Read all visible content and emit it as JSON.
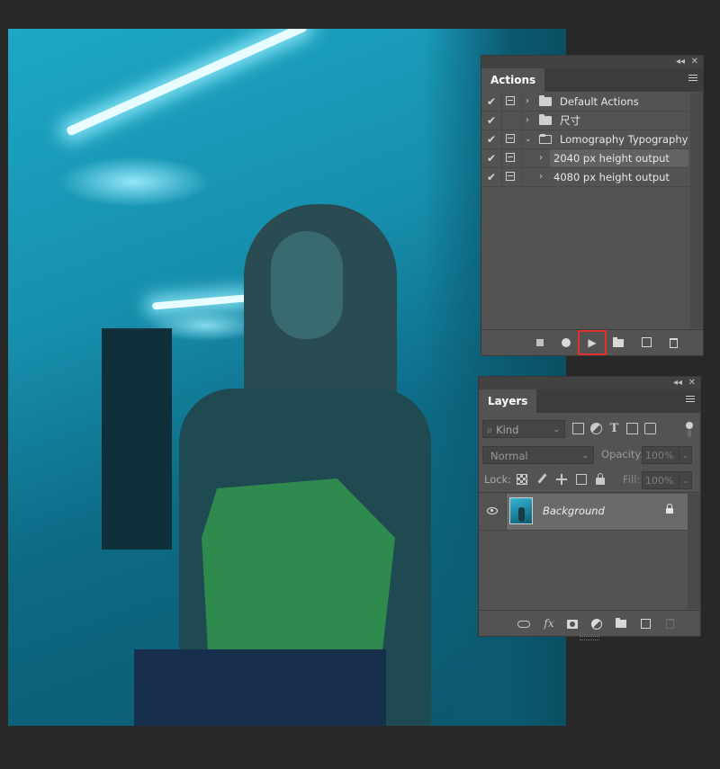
{
  "actions_panel": {
    "collapse_glyph": "◂◂",
    "close_glyph": "✕",
    "tab_label": "Actions",
    "items": [
      {
        "check": "✔",
        "dialog": true,
        "chevron": "›",
        "folder": true,
        "label": "Default Actions"
      },
      {
        "check": "✔",
        "dialog": false,
        "chevron": "›",
        "folder": true,
        "label": "尺寸"
      },
      {
        "check": "✔",
        "dialog": true,
        "chevron": "⌄",
        "folder": true,
        "label": "Lomography Typography ..."
      },
      {
        "check": "✔",
        "dialog": true,
        "chevron": "›",
        "folder": false,
        "label": "2040 px height output",
        "selected": true
      },
      {
        "check": "✔",
        "dialog": true,
        "chevron": "›",
        "folder": false,
        "label": "4080 px height output"
      }
    ],
    "footer": {
      "play_glyph": "▶",
      "highlight_color": "#e0312a"
    }
  },
  "layers_panel": {
    "collapse_glyph": "◂◂",
    "close_glyph": "✕",
    "tab_label": "Layers",
    "filter": {
      "kind_label": "⌕ Kind",
      "arrow": "⌄"
    },
    "blend_mode": "Normal",
    "opacity_label": "Opacity:",
    "opacity_value": "100%",
    "lock_label": "Lock:",
    "fill_label": "Fill:",
    "fill_value": "100%",
    "dropdown_arrow": "⌄",
    "layers": [
      {
        "name": "Background",
        "visible": true,
        "locked": true
      }
    ],
    "footer": {
      "fx_label": "fx"
    }
  },
  "colors": {
    "workspace_bg": "#282828",
    "panel_bg": "#535353",
    "selection_highlight": "#e0312a"
  }
}
